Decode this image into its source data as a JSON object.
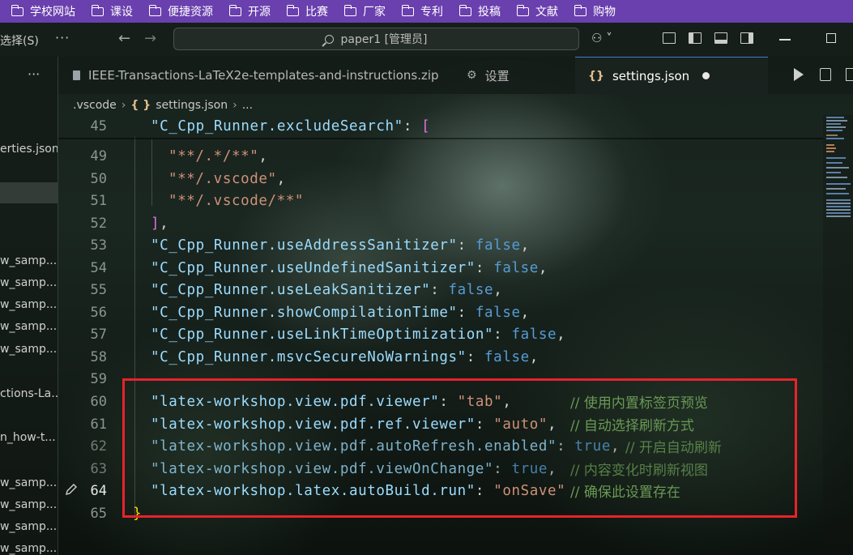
{
  "bookmarks": [
    "学校网站",
    "课设",
    "便捷资源",
    "开源",
    "比赛",
    "厂家",
    "专利",
    "投稿",
    "文献",
    "购物"
  ],
  "titlebar": {
    "menu_label": "选择(S)",
    "more": "···",
    "search_text": "paper1 [管理员]",
    "copilot_label": "⚇ ˅"
  },
  "sidebar": {
    "more": "···",
    "items": [
      "erties.json",
      "w_samp...",
      "w_samp...",
      "w_samp...",
      "w_samp...",
      "w_samp...",
      "ctions-La...",
      "n_how-t...",
      "w_samp...",
      "w_samp...",
      "w_samp...",
      "w_samp..."
    ]
  },
  "tabs": [
    {
      "label": "IEEE-Transactions-LaTeX2e-templates-and-instructions.zip",
      "icon": "zip-file-icon"
    },
    {
      "label": "设置",
      "icon": "gear-icon"
    },
    {
      "label": "settings.json",
      "icon": "json-icon",
      "active": true,
      "dirty": true
    }
  ],
  "breadcrumb": {
    "folder": ".vscode",
    "file": "settings.json",
    "tail": "...",
    "json_glyph": "{ }"
  },
  "editor": {
    "current_line": "64",
    "lines": [
      {
        "num": "45",
        "key": "\"C_Cpp_Runner.excludeSearch\"",
        "rest": ": ",
        "open": "["
      },
      {
        "num": "49",
        "str": "\"**/.*/**\"",
        "punct": ","
      },
      {
        "num": "50",
        "str": "\"**/.vscode\"",
        "punct": ","
      },
      {
        "num": "51",
        "str": "\"**/.vscode/**\""
      },
      {
        "num": "52",
        "close": "]",
        "punct": ","
      },
      {
        "num": "53",
        "key": "\"C_Cpp_Runner.useAddressSanitizer\"",
        "colon": ": ",
        "bool": "false",
        "punct": ","
      },
      {
        "num": "54",
        "key": "\"C_Cpp_Runner.useUndefinedSanitizer\"",
        "colon": ": ",
        "bool": "false",
        "punct": ","
      },
      {
        "num": "55",
        "key": "\"C_Cpp_Runner.useLeakSanitizer\"",
        "colon": ": ",
        "bool": "false",
        "punct": ","
      },
      {
        "num": "56",
        "key": "\"C_Cpp_Runner.showCompilationTime\"",
        "colon": ": ",
        "bool": "false",
        "punct": ","
      },
      {
        "num": "57",
        "key": "\"C_Cpp_Runner.useLinkTimeOptimization\"",
        "colon": ": ",
        "bool": "false",
        "punct": ","
      },
      {
        "num": "58",
        "key": "\"C_Cpp_Runner.msvcSecureNoWarnings\"",
        "colon": ": ",
        "bool": "false",
        "punct": ","
      },
      {
        "num": "59"
      },
      {
        "num": "60",
        "key": "\"latex-workshop.view.pdf.viewer\"",
        "colon": ": ",
        "str": "\"tab\"",
        "punct": ",",
        "comment": "// 使用内置标签页预览"
      },
      {
        "num": "61",
        "key": "\"latex-workshop.view.pdf.ref.viewer\"",
        "colon": ": ",
        "str": "\"auto\"",
        "punct": ",",
        "comment": "// 自动选择刷新方式"
      },
      {
        "num": "62",
        "key": "\"latex-workshop.view.pdf.autoRefresh.enabled\"",
        "colon": ": ",
        "bool": "true",
        "punct": ",",
        "comment": "// 开启自动刷新"
      },
      {
        "num": "63",
        "key": "\"latex-workshop.view.pdf.viewOnChange\"",
        "colon": ": ",
        "bool": "true",
        "punct": ",",
        "comment": "// 内容变化时刷新视图"
      },
      {
        "num": "64",
        "key": "\"latex-workshop.latex.autoBuild.run\"",
        "colon": ": ",
        "str": "\"onSave\"",
        "comment": "// 确保此设置存在"
      },
      {
        "num": "65",
        "close_brace": "}"
      }
    ]
  },
  "colors": {
    "bookmark_bar": "#6a3fae",
    "highlight_box": "#e8232a",
    "key": "#9cdcfe",
    "string": "#ce9178",
    "boolean": "#569cd6",
    "comment": "#6a9955"
  }
}
